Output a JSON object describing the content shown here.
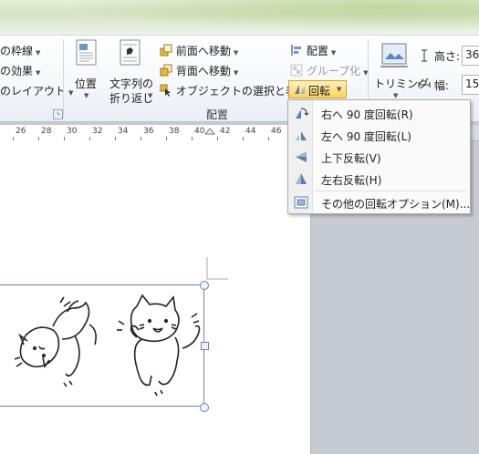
{
  "ribbon": {
    "left_col": {
      "border_label": "の枠線",
      "effects_label": "の効果",
      "layout_label": "のレイアウト"
    },
    "position_label": "位置",
    "wrap_label_line1": "文字列の",
    "wrap_label_line2": "折り返し",
    "bring_forward": "前面へ移動",
    "send_backward": "背面へ移動",
    "selection_pane": "オブジェクトの選択と表示",
    "align": "配置",
    "group": "グループ化",
    "rotate": "回転",
    "arrange_group": "配置",
    "crop_line1": "トリミング",
    "height_label": "高さ:",
    "height_value": "36",
    "width_label": "幅:",
    "width_value": "15"
  },
  "ruler": {
    "labels": [
      "26",
      "28",
      "30",
      "32",
      "34",
      "36",
      "38",
      "40",
      "42",
      "44",
      "46"
    ]
  },
  "menu": {
    "items": [
      {
        "label": "右へ 90 度回転(R)",
        "icon": "rotate-right-90-icon"
      },
      {
        "label": "左へ 90 度回転(L)",
        "icon": "rotate-left-90-icon"
      },
      {
        "label": "上下反転(V)",
        "icon": "flip-vertical-icon"
      },
      {
        "label": "左右反転(H)",
        "icon": "flip-horizontal-icon"
      },
      {
        "label": "その他の回転オプション(M)...",
        "icon": "more-rotation-options-icon"
      }
    ]
  },
  "colors": {
    "accent": "#ffd25f",
    "selection_border": "#6c86a5",
    "page_bg": "#ffffff",
    "workspace_bg": "#c6cbd1"
  }
}
